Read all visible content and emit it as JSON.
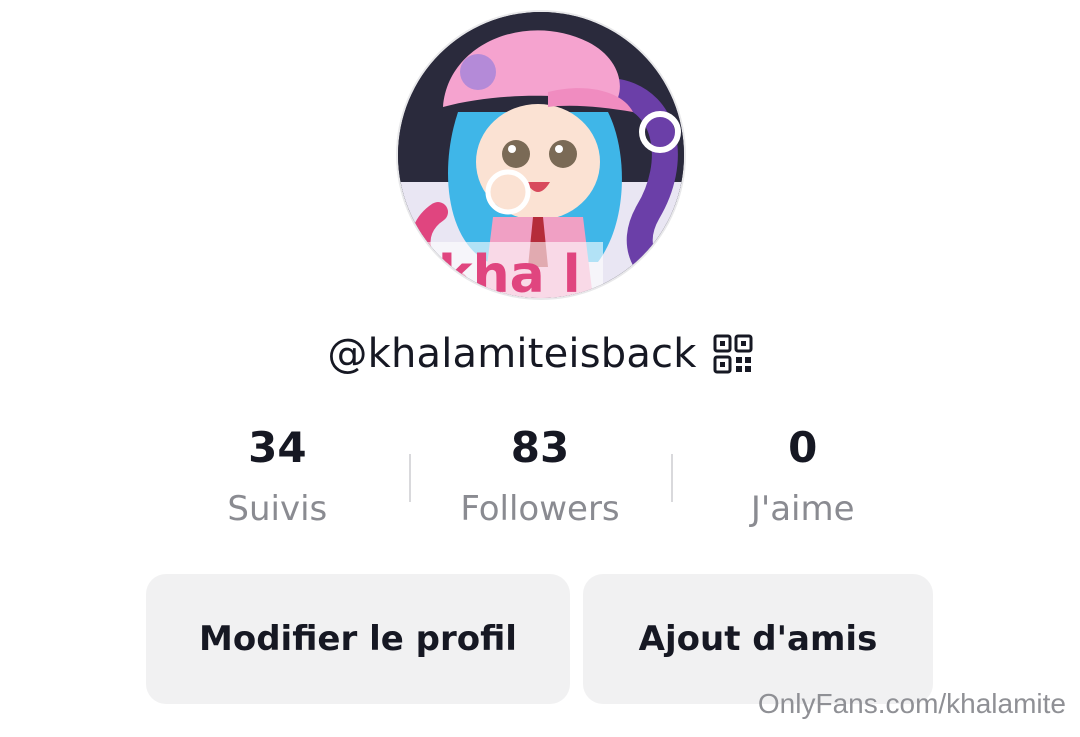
{
  "profile": {
    "avatar_icon": "anime-avatar-image",
    "username": "@khalamiteisback",
    "qr_icon": "qr-code-icon"
  },
  "stats": [
    {
      "value": "34",
      "label": "Suivis"
    },
    {
      "value": "83",
      "label": "Followers"
    },
    {
      "value": "0",
      "label": "J'aime"
    }
  ],
  "buttons": {
    "edit_profile": "Modifier le profil",
    "add_friends": "Ajout d'amis"
  },
  "watermark": "OnlyFans.com/khalamite",
  "colors": {
    "text_primary": "#161823",
    "text_secondary": "#8a8b91",
    "button_bg": "#f1f1f2"
  }
}
